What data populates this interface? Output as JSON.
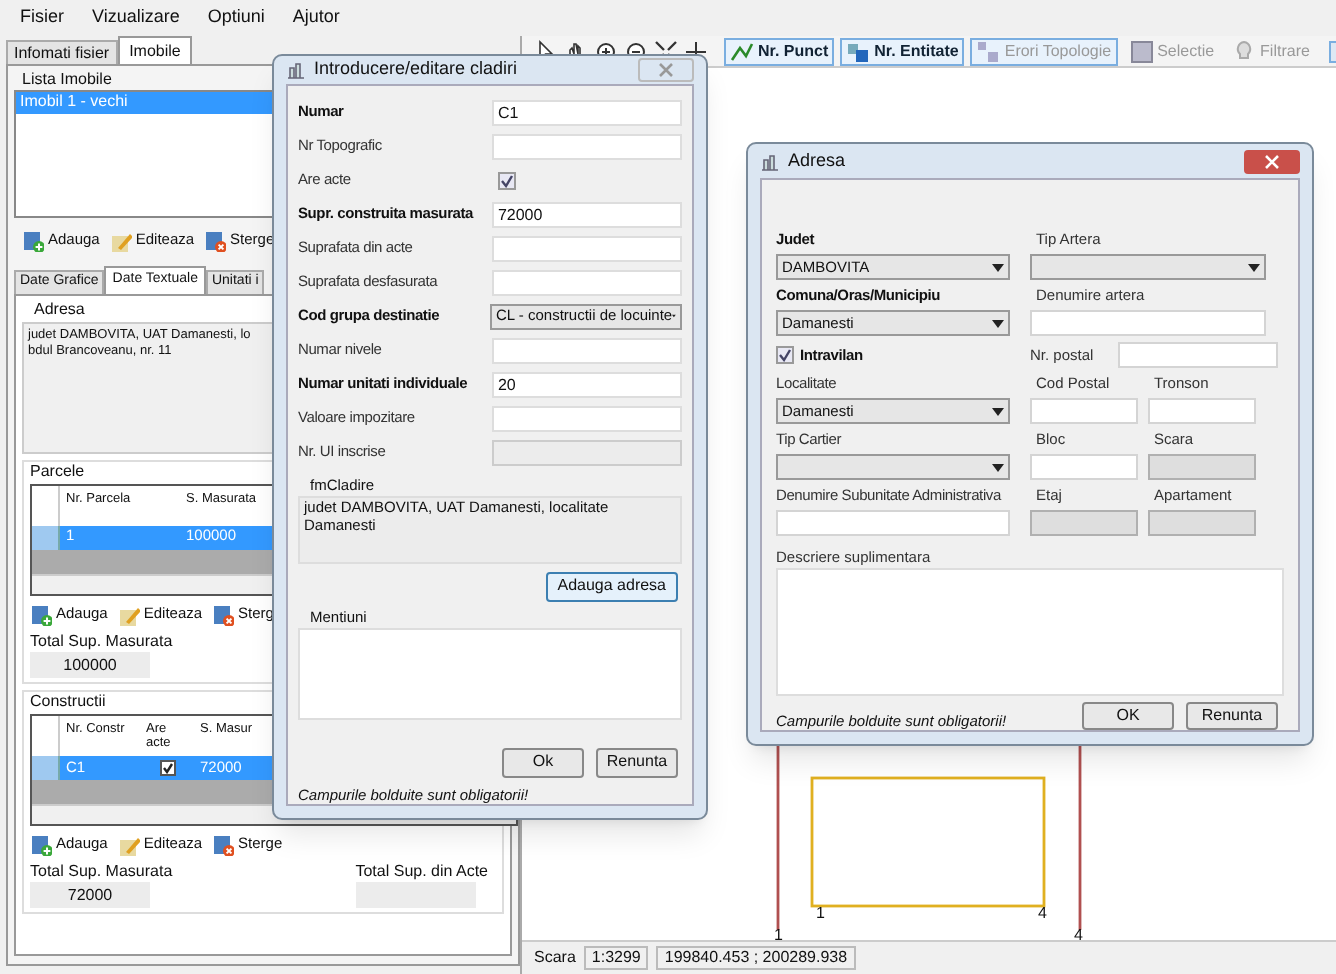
{
  "menu": [
    "Fisier",
    "Vizualizare",
    "Optiuni",
    "Ajutor"
  ],
  "left_tabs": [
    {
      "label": "Infomati fisier",
      "selected": false
    },
    {
      "label": "Imobile",
      "selected": true
    }
  ],
  "imobile_list": {
    "title": "Lista Imobile",
    "items": [
      {
        "label": "Imobil 1 - vechi",
        "selected": true
      }
    ]
  },
  "list_actions": [
    "Adauga",
    "Editeaza",
    "Sterge"
  ],
  "detail_tabs": [
    {
      "label": "Date Grafice",
      "selected": false
    },
    {
      "label": "Date Textuale",
      "selected": true
    },
    {
      "label": "Unitati i",
      "selected": false
    }
  ],
  "adresa": {
    "title": "Adresa",
    "lines": [
      "judet DAMBOVITA, UAT Damanesti, lo",
      "bdul Brancoveanu, nr. 11"
    ]
  },
  "parcele": {
    "title": "Parcele",
    "columns": [
      "Nr. Parcela",
      "S. Masurata"
    ],
    "rows": [
      {
        "cells": [
          "1",
          "100000"
        ],
        "selected": true
      }
    ],
    "actions": [
      "Adauga",
      "Editeaza",
      "Sterg"
    ],
    "total_label": "Total Sup. Masurata",
    "total": "100000"
  },
  "constructii": {
    "title": "Constructii",
    "columns": [
      "Nr. Constr",
      "Are acte",
      "S. Masur"
    ],
    "rows": [
      {
        "nr": "C1",
        "are_acte": true,
        "s_masurata": "72000",
        "selected": true
      }
    ],
    "actions": [
      "Adauga",
      "Editeaza",
      "Sterge"
    ],
    "totals": [
      {
        "label": "Total Sup. Masurata",
        "value": "72000"
      },
      {
        "label": "Total Sup. din Acte"
      }
    ]
  },
  "map_toolbar": [
    {
      "label": "Nr. Punct",
      "checked": true,
      "disabled": false
    },
    {
      "label": "Nr. Entitate",
      "checked": true,
      "disabled": false
    },
    {
      "label": "Erori Topologie",
      "checked": true,
      "disabled": true
    },
    {
      "label": "Selectie",
      "checked": false,
      "disabled": true
    },
    {
      "label": "Filtrare",
      "checked": false,
      "disabled": true
    }
  ],
  "map": {
    "point_labels": [
      "1",
      "4",
      "1",
      "4"
    ]
  },
  "status_bar": {
    "scale_label": "Scara",
    "scale": "1:3299",
    "coordinates": "199840.453 ; 200289.938"
  },
  "cladire_dialog": {
    "title": "Introducere/editare cladiri",
    "fields": [
      {
        "label": "Numar",
        "kind": "text",
        "required": true,
        "value": "C1"
      },
      {
        "label": "Nr Topografic",
        "kind": "text",
        "required": false
      },
      {
        "label": "Are acte",
        "kind": "checkbox",
        "required": false,
        "checked": true
      },
      {
        "label": "Supr. construita masurata",
        "kind": "text",
        "required": true,
        "value": "72000"
      },
      {
        "label": "Suprafata din acte",
        "kind": "text",
        "required": false
      },
      {
        "label": "Suprafata desfasurata",
        "kind": "text",
        "required": false
      },
      {
        "label": "Cod grupa destinatie",
        "kind": "select",
        "required": true,
        "value": "CL - constructii de locuinte"
      },
      {
        "label": "Numar nivele",
        "kind": "text",
        "required": false
      },
      {
        "label": "Numar unitati individuale",
        "kind": "text",
        "required": true,
        "value": "20"
      },
      {
        "label": "Valoare impozitare",
        "kind": "text",
        "required": false
      },
      {
        "label": "Nr. UI inscrise",
        "kind": "readonly",
        "required": false
      }
    ],
    "address_group": {
      "title": "fmCladire",
      "text": "judet DAMBOVITA, UAT Damanesti, localitate Damanesti"
    },
    "add_address_button": "Adauga adresa",
    "mentiuni_title": "Mentiuni",
    "buttons": [
      "Ok",
      "Renunta"
    ],
    "footer": "Campurile bolduite sunt obligatorii!"
  },
  "adresa_dialog": {
    "title": "Adresa",
    "left": [
      {
        "label": "Judet",
        "kind": "select",
        "required": true,
        "value": "DAMBOVITA"
      },
      {
        "label": "Comuna/Oras/Municipiu",
        "kind": "select",
        "required": true,
        "value": "Damanesti"
      },
      {
        "label": "Intravilan",
        "kind": "checkbox",
        "required": true,
        "checked": true
      },
      {
        "label": "Localitate",
        "kind": "select",
        "required": false,
        "value": "Damanesti"
      },
      {
        "label": "Tip Cartier",
        "kind": "select",
        "required": false
      },
      {
        "label": "Denumire Subunitate Administrativa",
        "kind": "text",
        "required": false
      }
    ],
    "right": [
      {
        "label": "Tip Artera",
        "kind": "select"
      },
      {
        "label": "Denumire artera",
        "kind": "text"
      },
      {
        "label": "Nr. postal",
        "kind": "inline"
      },
      {
        "kind": "pair",
        "items": [
          {
            "label": "Cod Postal",
            "disabled": false
          },
          {
            "label": "Tronson",
            "disabled": false
          }
        ]
      },
      {
        "kind": "pair",
        "items": [
          {
            "label": "Bloc",
            "disabled": false
          },
          {
            "label": "Scara",
            "disabled": true
          }
        ]
      },
      {
        "kind": "pair",
        "items": [
          {
            "label": "Etaj",
            "disabled": true
          },
          {
            "label": "Apartament",
            "disabled": true
          }
        ]
      }
    ],
    "description_label": "Descriere suplimentara",
    "buttons": [
      "OK",
      "Renunta"
    ],
    "footer": "Campurile bolduite sunt obligatorii!"
  }
}
